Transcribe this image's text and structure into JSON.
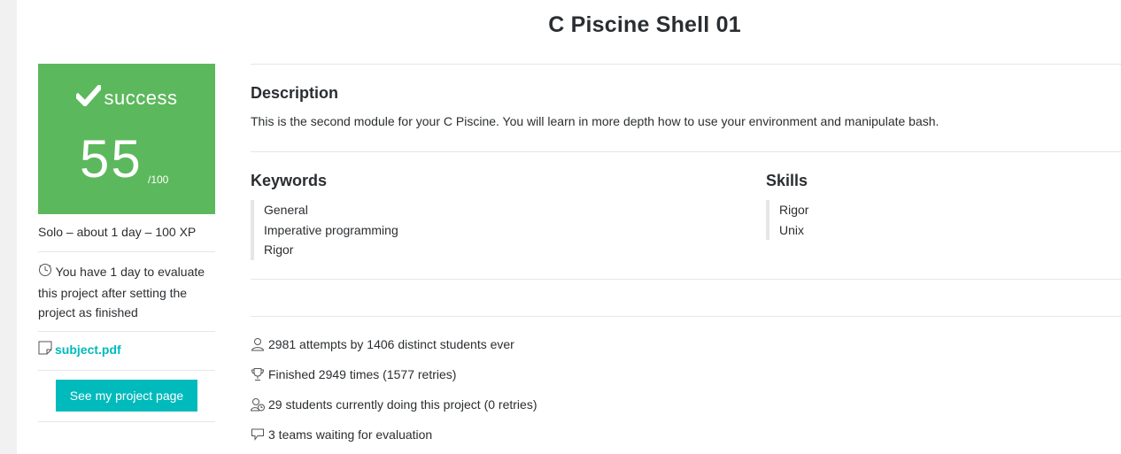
{
  "project": {
    "title": "C Piscine Shell 01"
  },
  "status": {
    "label": "success",
    "grade": "55",
    "grade_max": "/100",
    "color": "#5cb85c"
  },
  "meta": {
    "line": "Solo – about 1 day – 100 XP"
  },
  "evaluation_note": "You have 1 day to evaluate this project after setting the project as finished",
  "subject": {
    "link_text": "subject.pdf"
  },
  "actions": {
    "project_page_button": "See my project page"
  },
  "description": {
    "heading": "Description",
    "text": "This is the second module for your C Piscine. You will learn in more depth how to use your environment and manipulate bash."
  },
  "keywords": {
    "heading": "Keywords",
    "items": [
      "General",
      "Imperative programming",
      "Rigor"
    ]
  },
  "skills": {
    "heading": "Skills",
    "items": [
      "Rigor",
      "Unix"
    ]
  },
  "stats": [
    {
      "icon": "user-icon",
      "text": "2981 attempts by 1406 distinct students ever"
    },
    {
      "icon": "trophy-icon",
      "text": "Finished 2949 times (1577 retries)"
    },
    {
      "icon": "user-clock-icon",
      "text": "29 students currently doing this project (0 retries)"
    },
    {
      "icon": "chat-bubble-icon",
      "text": "3 teams waiting for evaluation"
    }
  ],
  "colors": {
    "accent": "#00babc",
    "success": "#5cb85c"
  }
}
